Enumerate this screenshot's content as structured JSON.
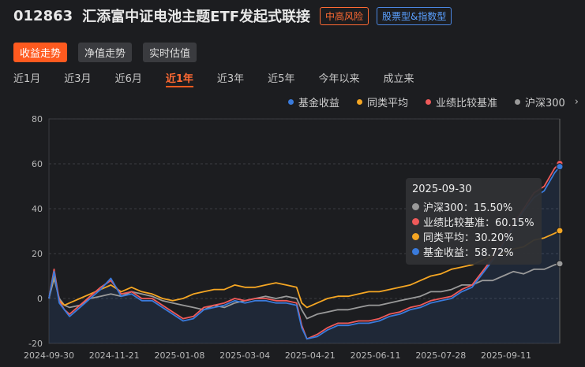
{
  "header": {
    "fund_code": "012863",
    "fund_name": "汇添富中证电池主题ETF发起式联接",
    "risk_badge": "中高风险",
    "type_badge": "股票型&指数型"
  },
  "view_tabs": [
    "收益走势",
    "净值走势",
    "实时估值"
  ],
  "period_tabs": [
    "近1月",
    "近3月",
    "近6月",
    "近1年",
    "近3年",
    "近5年",
    "今年以来",
    "成立来"
  ],
  "active_period": "近1年",
  "legend": [
    {
      "name": "基金收益",
      "color": "#3a7bdc"
    },
    {
      "name": "同类平均",
      "color": "#f5a623"
    },
    {
      "name": "业绩比较基准",
      "color": "#ef5a5a"
    },
    {
      "name": "沪深300",
      "color": "#9a9a9a"
    }
  ],
  "tooltip": {
    "date": "2025-09-30",
    "rows": [
      {
        "label": "沪深300：15.50%",
        "color": "#9a9a9a"
      },
      {
        "label": "业绩比较基准：60.15%",
        "color": "#ef5a5a"
      },
      {
        "label": "同类平均：30.20%",
        "color": "#f5a623"
      },
      {
        "label": "基金收益：58.72%",
        "color": "#3a7bdc"
      }
    ]
  },
  "chart_data": {
    "type": "line",
    "ylim": [
      -20,
      80
    ],
    "yticks": [
      80,
      60,
      40,
      20,
      0,
      -20
    ],
    "xticks": [
      "2024-09-30",
      "2024-11-21",
      "2025-01-08",
      "2025-03-04",
      "2025-04-21",
      "2025-06-11",
      "2025-07-28",
      "2025-09-11"
    ],
    "series": [
      {
        "name": "沪深300",
        "color": "#9a9a9a",
        "values": [
          [
            0,
            0
          ],
          [
            1,
            9
          ],
          [
            2,
            0
          ],
          [
            3,
            -3
          ],
          [
            4,
            -4
          ],
          [
            6,
            -3
          ],
          [
            8,
            0
          ],
          [
            10,
            1
          ],
          [
            12,
            2
          ],
          [
            14,
            1
          ],
          [
            16,
            3
          ],
          [
            18,
            2
          ],
          [
            20,
            1
          ],
          [
            22,
            -1
          ],
          [
            24,
            -2
          ],
          [
            26,
            -3
          ],
          [
            28,
            -4
          ],
          [
            30,
            -5
          ],
          [
            32,
            -3
          ],
          [
            34,
            -4
          ],
          [
            36,
            -2
          ],
          [
            38,
            -1
          ],
          [
            40,
            0
          ],
          [
            42,
            1
          ],
          [
            44,
            0
          ],
          [
            46,
            1
          ],
          [
            48,
            0
          ],
          [
            49,
            -5
          ],
          [
            50,
            -9
          ],
          [
            52,
            -7
          ],
          [
            54,
            -6
          ],
          [
            56,
            -5
          ],
          [
            58,
            -5
          ],
          [
            60,
            -4
          ],
          [
            62,
            -3
          ],
          [
            64,
            -3
          ],
          [
            66,
            -2
          ],
          [
            68,
            -1
          ],
          [
            70,
            0
          ],
          [
            72,
            1
          ],
          [
            74,
            3
          ],
          [
            76,
            3
          ],
          [
            78,
            4
          ],
          [
            80,
            6
          ],
          [
            82,
            6
          ],
          [
            84,
            8
          ],
          [
            86,
            8
          ],
          [
            88,
            10
          ],
          [
            90,
            12
          ],
          [
            92,
            11
          ],
          [
            94,
            13
          ],
          [
            96,
            13
          ],
          [
            98,
            15
          ],
          [
            99,
            15.5
          ]
        ]
      },
      {
        "name": "同类平均",
        "color": "#f5a623",
        "values": [
          [
            0,
            0
          ],
          [
            1,
            11
          ],
          [
            2,
            -1
          ],
          [
            3,
            -3
          ],
          [
            4,
            -2
          ],
          [
            6,
            0
          ],
          [
            8,
            2
          ],
          [
            10,
            4
          ],
          [
            12,
            6
          ],
          [
            14,
            3
          ],
          [
            16,
            5
          ],
          [
            18,
            3
          ],
          [
            20,
            2
          ],
          [
            22,
            0
          ],
          [
            24,
            -1
          ],
          [
            26,
            0
          ],
          [
            28,
            2
          ],
          [
            30,
            3
          ],
          [
            32,
            4
          ],
          [
            34,
            4
          ],
          [
            36,
            6
          ],
          [
            38,
            5
          ],
          [
            40,
            5
          ],
          [
            42,
            6
          ],
          [
            44,
            7
          ],
          [
            46,
            6
          ],
          [
            48,
            5
          ],
          [
            49,
            -2
          ],
          [
            50,
            -4
          ],
          [
            52,
            -2
          ],
          [
            54,
            0
          ],
          [
            56,
            1
          ],
          [
            58,
            1
          ],
          [
            60,
            2
          ],
          [
            62,
            3
          ],
          [
            64,
            3
          ],
          [
            66,
            4
          ],
          [
            68,
            5
          ],
          [
            70,
            6
          ],
          [
            72,
            8
          ],
          [
            74,
            10
          ],
          [
            76,
            11
          ],
          [
            78,
            13
          ],
          [
            80,
            14
          ],
          [
            82,
            15
          ],
          [
            84,
            17
          ],
          [
            86,
            19
          ],
          [
            88,
            20
          ],
          [
            90,
            22
          ],
          [
            92,
            23
          ],
          [
            94,
            26
          ],
          [
            96,
            27
          ],
          [
            98,
            29
          ],
          [
            99,
            30.2
          ]
        ]
      },
      {
        "name": "业绩比较基准",
        "color": "#ef5a5a",
        "values": [
          [
            0,
            0
          ],
          [
            1,
            13
          ],
          [
            2,
            -1
          ],
          [
            3,
            -5
          ],
          [
            4,
            -7
          ],
          [
            6,
            -3
          ],
          [
            8,
            1
          ],
          [
            10,
            5
          ],
          [
            12,
            8
          ],
          [
            14,
            2
          ],
          [
            16,
            3
          ],
          [
            18,
            0
          ],
          [
            20,
            0
          ],
          [
            22,
            -3
          ],
          [
            24,
            -6
          ],
          [
            26,
            -9
          ],
          [
            28,
            -8
          ],
          [
            30,
            -4
          ],
          [
            32,
            -3
          ],
          [
            34,
            -2
          ],
          [
            36,
            0
          ],
          [
            38,
            -1
          ],
          [
            40,
            0
          ],
          [
            42,
            0
          ],
          [
            44,
            -1
          ],
          [
            46,
            -1
          ],
          [
            48,
            -2
          ],
          [
            49,
            -12
          ],
          [
            50,
            -18
          ],
          [
            52,
            -16
          ],
          [
            54,
            -13
          ],
          [
            56,
            -11
          ],
          [
            58,
            -11
          ],
          [
            60,
            -10
          ],
          [
            62,
            -10
          ],
          [
            64,
            -9
          ],
          [
            66,
            -7
          ],
          [
            68,
            -6
          ],
          [
            70,
            -4
          ],
          [
            72,
            -3
          ],
          [
            74,
            -1
          ],
          [
            76,
            0
          ],
          [
            78,
            1
          ],
          [
            80,
            4
          ],
          [
            82,
            6
          ],
          [
            84,
            12
          ],
          [
            86,
            18
          ],
          [
            88,
            25
          ],
          [
            90,
            33
          ],
          [
            92,
            40
          ],
          [
            94,
            47
          ],
          [
            96,
            50
          ],
          [
            98,
            58
          ],
          [
            99,
            60.15
          ]
        ]
      },
      {
        "name": "基金收益",
        "color": "#3a7bdc",
        "values": [
          [
            0,
            0
          ],
          [
            1,
            12
          ],
          [
            2,
            -2
          ],
          [
            3,
            -5
          ],
          [
            4,
            -8
          ],
          [
            6,
            -4
          ],
          [
            8,
            0
          ],
          [
            10,
            4
          ],
          [
            12,
            9
          ],
          [
            14,
            1
          ],
          [
            16,
            2
          ],
          [
            18,
            -1
          ],
          [
            20,
            -1
          ],
          [
            22,
            -4
          ],
          [
            24,
            -7
          ],
          [
            26,
            -10
          ],
          [
            28,
            -9
          ],
          [
            30,
            -5
          ],
          [
            32,
            -4
          ],
          [
            34,
            -3
          ],
          [
            36,
            -1
          ],
          [
            38,
            -2
          ],
          [
            40,
            -1
          ],
          [
            42,
            -1
          ],
          [
            44,
            -2
          ],
          [
            46,
            -2
          ],
          [
            48,
            -3
          ],
          [
            49,
            -13
          ],
          [
            50,
            -18
          ],
          [
            52,
            -17
          ],
          [
            54,
            -14
          ],
          [
            56,
            -12
          ],
          [
            58,
            -12
          ],
          [
            60,
            -11
          ],
          [
            62,
            -11
          ],
          [
            64,
            -10
          ],
          [
            66,
            -8
          ],
          [
            68,
            -7
          ],
          [
            70,
            -5
          ],
          [
            72,
            -4
          ],
          [
            74,
            -2
          ],
          [
            76,
            -1
          ],
          [
            78,
            0
          ],
          [
            80,
            3
          ],
          [
            82,
            5
          ],
          [
            84,
            11
          ],
          [
            86,
            17
          ],
          [
            88,
            24
          ],
          [
            90,
            32
          ],
          [
            92,
            39
          ],
          [
            94,
            45
          ],
          [
            96,
            48
          ],
          [
            98,
            56
          ],
          [
            99,
            58.72
          ]
        ]
      }
    ]
  }
}
